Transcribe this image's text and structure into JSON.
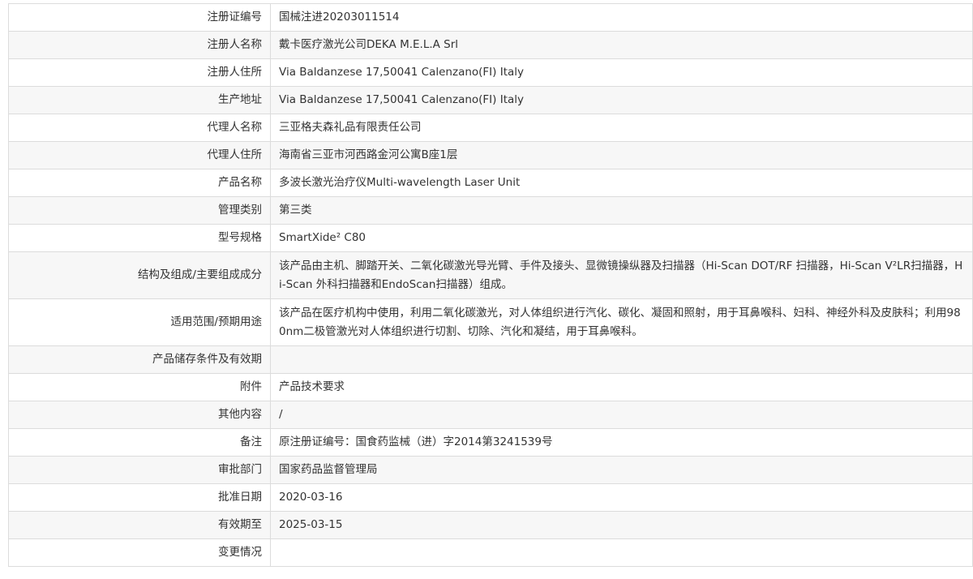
{
  "rows": [
    {
      "label": "注册证编号",
      "value": "国械注进20203011514",
      "tall": false
    },
    {
      "label": "注册人名称",
      "value": "戴卡医疗激光公司DEKA M.E.L.A Srl",
      "tall": false
    },
    {
      "label": "注册人住所",
      "value": "Via Baldanzese 17,50041 Calenzano(FI) Italy",
      "tall": false
    },
    {
      "label": "生产地址",
      "value": "Via Baldanzese 17,50041 Calenzano(FI) Italy",
      "tall": false
    },
    {
      "label": "代理人名称",
      "value": "三亚格夫森礼品有限责任公司",
      "tall": false
    },
    {
      "label": "代理人住所",
      "value": "海南省三亚市河西路金河公寓B座1层",
      "tall": false
    },
    {
      "label": "产品名称",
      "value": "多波长激光治疗仪Multi-wavelength Laser Unit",
      "tall": false
    },
    {
      "label": "管理类别",
      "value": "第三类",
      "tall": false
    },
    {
      "label": "型号规格",
      "value": "SmartXide² C80",
      "tall": false
    },
    {
      "label": "结构及组成/主要组成成分",
      "value": "该产品由主机、脚踏开关、二氧化碳激光导光臂、手件及接头、显微镜操纵器及扫描器（Hi-Scan DOT/RF 扫描器，Hi-Scan V²LR扫描器，Hi-Scan 外科扫描器和EndoScan扫描器）组成。",
      "tall": true
    },
    {
      "label": "适用范围/预期用途",
      "value": "该产品在医疗机构中使用，利用二氧化碳激光，对人体组织进行汽化、碳化、凝固和照射，用于耳鼻喉科、妇科、神经外科及皮肤科；利用980nm二极管激光对人体组织进行切割、切除、汽化和凝结，用于耳鼻喉科。",
      "tall": true
    },
    {
      "label": "产品储存条件及有效期",
      "value": "",
      "tall": false
    },
    {
      "label": "附件",
      "value": "产品技术要求",
      "tall": false
    },
    {
      "label": "其他内容",
      "value": "/",
      "tall": false
    },
    {
      "label": "备注",
      "value": "原注册证编号：国食药监械（进）字2014第3241539号",
      "tall": false
    },
    {
      "label": "审批部门",
      "value": "国家药品监督管理局",
      "tall": false
    },
    {
      "label": "批准日期",
      "value": "2020-03-16",
      "tall": false
    },
    {
      "label": "有效期至",
      "value": "2025-03-15",
      "tall": false
    },
    {
      "label": "变更情况",
      "value": "",
      "tall": false
    }
  ]
}
